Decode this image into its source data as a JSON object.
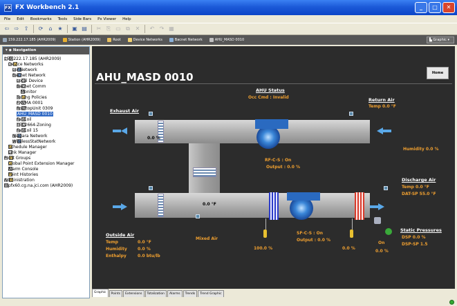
{
  "window": {
    "title": "FX Workbench 2.1",
    "controls": [
      "minimize",
      "maximize",
      "close"
    ]
  },
  "menu": [
    "File",
    "Edit",
    "Bookmarks",
    "Tools",
    "Side Bars",
    "Px Viewer",
    "Help"
  ],
  "breadcrumbs": [
    "159.222.17.185 (AHR2009)",
    "Station (AHR2009)",
    "Root",
    "Device Networks",
    "Bacnet Network",
    "AHU_MASD 0010"
  ],
  "view_selector": "Graphic",
  "nav": {
    "title": "Navigation",
    "items": [
      {
        "label": "159.222.17.185 (AHR2009)"
      },
      {
        "label": "Device Networks"
      },
      {
        "label": "LonNetwork"
      },
      {
        "label": "Bacnet Network"
      },
      {
        "label": "Local Device"
      },
      {
        "label": "Bacnet Comm"
      },
      {
        "label": "Monitor"
      },
      {
        "label": "Tuning Policies"
      },
      {
        "label": "FXVMA 0001"
      },
      {
        "label": "RooftopUnit 0309"
      },
      {
        "label": "AHU_MASD 0010"
      },
      {
        "label": "FanCoil"
      },
      {
        "label": "TEC2664-Zoning"
      },
      {
        "label": "FanCoil 15"
      },
      {
        "label": "Niagara Network"
      },
      {
        "label": "WirelessStatNetwork"
      },
      {
        "label": "Schedule Manager"
      },
      {
        "label": "Link Manager"
      },
      {
        "label": "Point Groups"
      },
      {
        "label": "Global Point Extension Manager"
      },
      {
        "label": "Alarm Console"
      },
      {
        "label": "Point Histories"
      },
      {
        "label": "Administration"
      },
      {
        "label": "mpfx60.cg.na.jci.com (AHR2009)"
      }
    ]
  },
  "graphic": {
    "page_title": "AHU_MASD 0010",
    "home_label": "Home",
    "ahu_status": {
      "title": "AHU Status",
      "occ": "Occ Cmd : Invalid"
    },
    "exhaust_air": "Exhaust Air",
    "exhaust_pct": "0.0 %",
    "return_air": {
      "title": "Return Air",
      "temp": "Temp   0.0 °F"
    },
    "return_humidity": "Humidity  0.0 %",
    "rf": {
      "cs": "RF-C-S :  On",
      "output": "Output :  0.0 %"
    },
    "mixed_temp": "0.0 °F",
    "mixed_air": "Mixed Air",
    "outside_air": {
      "title": "Outside Air",
      "temp_label": "Temp",
      "temp": "0.0 °F",
      "hum_label": "Humidity",
      "hum": "0.0 %",
      "enth_label": "Enthalpy",
      "enth": "0.0 btu/lb"
    },
    "sf": {
      "cs": "SF-C-S :  On",
      "output": "Output :  0.0 %"
    },
    "htg_valve": "100.0 %",
    "clg_valve": "0.0 %",
    "humid_cmd": "On",
    "humid_pct": "0.0 %",
    "discharge_air": {
      "title": "Discharge Air",
      "temp": "Temp     0.0 °F",
      "dat_sp": "DAT-SP  55.0 °F"
    },
    "static_pressures": {
      "title": "Static Pressures",
      "dsp": "DSP       0.0 %",
      "dsp_sp": "DSP-SP   1.5"
    },
    "colors": {
      "accent": "#f0a030",
      "background": "#2c2c2c",
      "airflow": "#5aa8e8"
    }
  },
  "tabs": [
    "Graphic",
    "Points",
    "Extensions",
    "Totalization",
    "Alarms",
    "Trends",
    "Trend Graphic"
  ]
}
